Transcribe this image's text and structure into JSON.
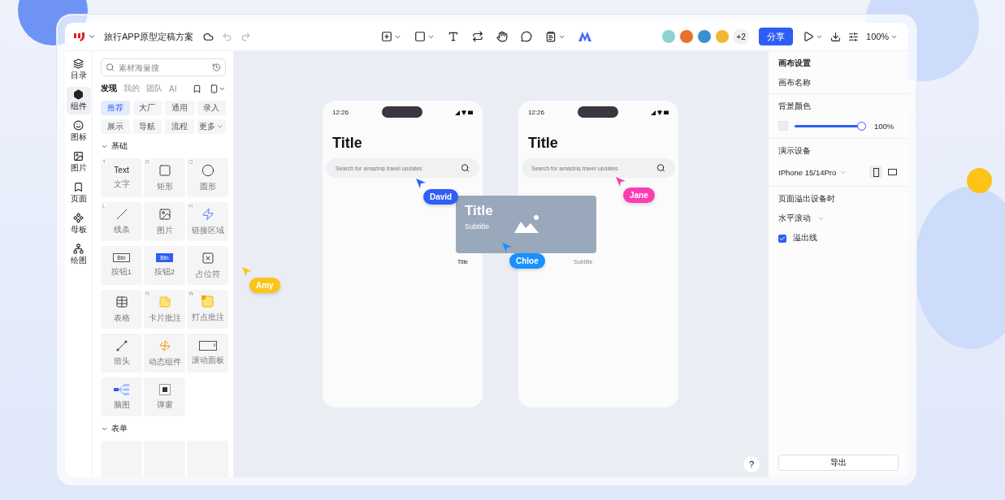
{
  "header": {
    "title": "旅行APP原型定稿方案",
    "avatars": [
      {
        "color": "#8fd3d0"
      },
      {
        "color": "#e8702a"
      },
      {
        "color": "#3a8fd0"
      },
      {
        "color": "#f2b632"
      }
    ],
    "more_count": "+2",
    "share": "分享",
    "zoom": "100%"
  },
  "rail": [
    {
      "label": "目录",
      "selected": false
    },
    {
      "label": "组件",
      "selected": true
    },
    {
      "label": "图标",
      "selected": false
    },
    {
      "label": "图片",
      "selected": false
    },
    {
      "label": "页面",
      "selected": false
    },
    {
      "label": "母板",
      "selected": false
    },
    {
      "label": "绘图",
      "selected": false
    }
  ],
  "library": {
    "search": {
      "placeholder": "素材海量搜"
    },
    "tabs": [
      {
        "label": "发现",
        "selected": true
      },
      {
        "label": "我的",
        "selected": false
      },
      {
        "label": "团队",
        "selected": false
      },
      {
        "label": "AI",
        "selected": false
      }
    ],
    "chips": [
      {
        "label": "推荐",
        "selected": true
      },
      {
        "label": "大厂",
        "selected": false
      },
      {
        "label": "通用",
        "selected": false
      },
      {
        "label": "录入",
        "selected": false
      },
      {
        "label": "展示",
        "selected": false
      },
      {
        "label": "导航",
        "selected": false
      },
      {
        "label": "流程",
        "selected": false
      },
      {
        "label": "更多",
        "selected": false,
        "dropdown": true
      }
    ],
    "sections": [
      {
        "title": "基础",
        "expanded": true,
        "items": [
          {
            "kind": "text",
            "icon_text": "Text",
            "label": "文字",
            "shortcut": "T"
          },
          {
            "kind": "rect",
            "label": "矩形",
            "shortcut": "R"
          },
          {
            "kind": "circle",
            "label": "圆形",
            "shortcut": "O"
          },
          {
            "kind": "line",
            "label": "线条",
            "shortcut": "L"
          },
          {
            "kind": "image",
            "label": "图片"
          },
          {
            "kind": "hotspot",
            "label": "链接区域",
            "shortcut": "H"
          },
          {
            "kind": "button_outline",
            "icon_text": "Btn",
            "label": "按钮1"
          },
          {
            "kind": "button_filled",
            "icon_text": "Btn",
            "label": "按钮2"
          },
          {
            "kind": "placeholder",
            "label": "占位符"
          },
          {
            "kind": "table",
            "label": "表格"
          },
          {
            "kind": "card_note",
            "label": "卡片批注",
            "shortcut": "N"
          },
          {
            "kind": "pin_note",
            "label": "打点批注",
            "shortcut": "W"
          },
          {
            "kind": "arrow",
            "label": "箭头"
          },
          {
            "kind": "dynamic",
            "label": "动态组件"
          },
          {
            "kind": "scroll",
            "label": "滚动面板"
          },
          {
            "kind": "mindmap",
            "label": "脑图"
          },
          {
            "kind": "popup",
            "label": "弹窗"
          }
        ]
      },
      {
        "title": "表单",
        "expanded": true,
        "items": [
          {
            "kind": "blank"
          },
          {
            "kind": "blank"
          },
          {
            "kind": "blank"
          }
        ]
      }
    ]
  },
  "canvas": {
    "phones": [
      {
        "time": "12:26",
        "title": "Title",
        "search_placeholder": "Search for amazing travel updates"
      },
      {
        "time": "12:26",
        "title": "Title",
        "search_placeholder": "Search for amazing travel updates"
      }
    ],
    "card": {
      "title": "Title",
      "subtitle": "Subtitle"
    },
    "labels": [
      {
        "text": "Title",
        "faint": false
      },
      {
        "text": "Subtitle",
        "faint": true
      }
    ],
    "cursors": [
      {
        "name": "David",
        "color": "#2f5ef6"
      },
      {
        "name": "Jane",
        "color": "#fb3db4"
      },
      {
        "name": "Chloe",
        "color": "#1890ff"
      },
      {
        "name": "Amy",
        "color": "#fcc419"
      }
    ],
    "help": "?"
  },
  "inspector": {
    "title": "画布设置",
    "canvas_name": "画布名称",
    "background": {
      "label": "背景颜色",
      "opacity": {
        "level": 1
      },
      "reading": "100%"
    },
    "device": {
      "label": "演示设备",
      "value": "IPhone 15/14Pro",
      "orientations": [
        {
          "kind": "portrait",
          "selected": true
        },
        {
          "kind": "landscape",
          "selected": false
        }
      ]
    },
    "overflow": {
      "label": "页面溢出设备时",
      "mode": "水平滚动",
      "overflow_line": {
        "label": "溢出线",
        "checked": true
      }
    },
    "export": "导出"
  }
}
